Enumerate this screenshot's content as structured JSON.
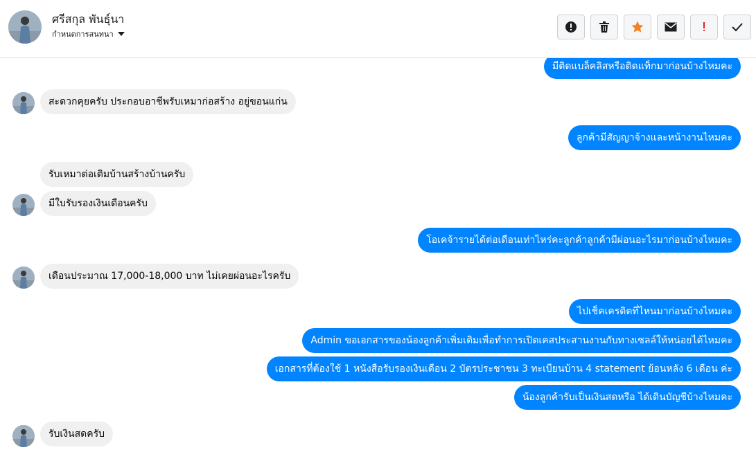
{
  "header": {
    "contact_name": "ศรีสกุล พันธุ์นา",
    "subtitle": "กำหนดการสนทนา"
  },
  "toolbar": {
    "icons": [
      "alert-circle-icon",
      "trash-icon",
      "star-icon",
      "envelope-icon",
      "exclamation-icon",
      "checkmark-icon"
    ],
    "star_color": "#f5821f",
    "mark_color": "#e02020"
  },
  "colors": {
    "outgoing_bubble": "#0084ff",
    "incoming_bubble": "#f0f0f0"
  },
  "messages": [
    {
      "direction": "outgoing",
      "text": "มีติดแบล็คลิสหรือติดแท็กมาก่อนบ้างไหมคะ"
    },
    {
      "direction": "incoming",
      "text": "สะดวกคุยครับ ประกอบอาชีพรับเหมาก่อสร้าง อยู่ขอนแก่น"
    },
    {
      "direction": "outgoing",
      "text": "ลูกค้ามีสัญญาจ้างและหน้างานไหมคะ"
    },
    {
      "direction": "incoming",
      "text": "รับเหมาต่อเติมบ้านสร้างบ้านครับ"
    },
    {
      "direction": "incoming",
      "text": "มีใบรับรองเงินเดือนครับ"
    },
    {
      "direction": "outgoing",
      "text": "โอเคจ้ารายได้ต่อเดือนเท่าไหร่คะลูกค้าลูกค้ามีผ่อนอะไรมาก่อนบ้างไหมคะ"
    },
    {
      "direction": "incoming",
      "text": "เดือนประมาณ 17,000-18,000 บาท ไม่เคยผ่อนอะไรครับ"
    },
    {
      "direction": "outgoing",
      "text": "ไปเช็คเครดิตที่ไหนมาก่อนบ้างไหมคะ"
    },
    {
      "direction": "outgoing",
      "text": "Admin ขอเอกสารของน้องลูกค้าเพิ่มเติมเพื่อทำการเปิดเคสประสานงานกับทางเซลล์ให้หน่อยได้ไหมคะ"
    },
    {
      "direction": "outgoing",
      "text": "เอกสารที่ต้องใช้ 1 หนังสือรับรองเงินเดือน 2 บัตรประชาชน 3 ทะเบียนบ้าน 4 statement ย้อนหลัง 6 เดือน ค่ะ"
    },
    {
      "direction": "outgoing",
      "text": "น้องลูกค้ารับเป็นเงินสดหรือ ได้เดินบัญชีบ้างไหมคะ"
    },
    {
      "direction": "incoming",
      "text": "รับเงินสดครับ"
    }
  ]
}
